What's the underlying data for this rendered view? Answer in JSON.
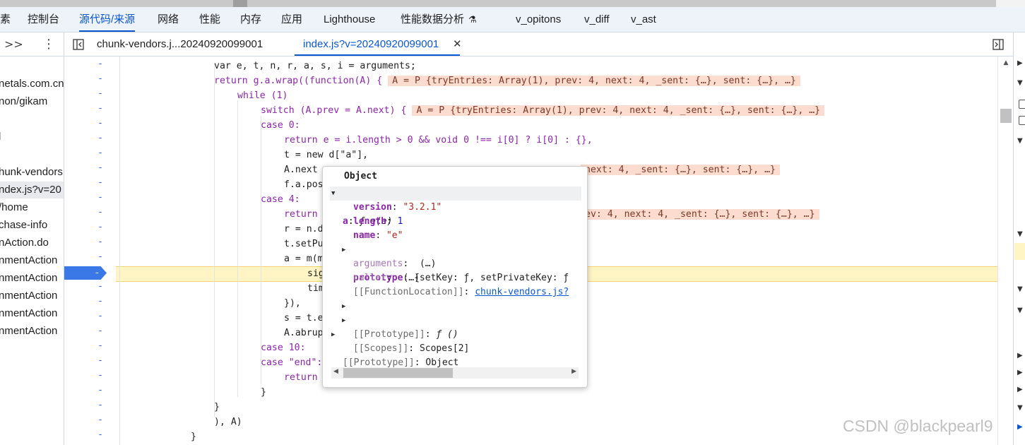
{
  "main_tabs": [
    {
      "label": "素",
      "active": false
    },
    {
      "label": "控制台",
      "active": false
    },
    {
      "label": "源代码/来源",
      "active": true
    },
    {
      "label": "网络",
      "active": false
    },
    {
      "label": "性能",
      "active": false
    },
    {
      "label": "内存",
      "active": false
    },
    {
      "label": "应用",
      "active": false
    },
    {
      "label": "Lighthouse",
      "active": false
    },
    {
      "label": "性能数据分析",
      "active": false
    },
    {
      "label": "v_opitons",
      "active": false
    },
    {
      "label": "v_diff",
      "active": false
    },
    {
      "label": "v_ast",
      "active": false
    }
  ],
  "file_tabs": [
    {
      "label": "chunk-vendors.j...20240920099001",
      "active": false
    },
    {
      "label": "index.js?v=20240920099001",
      "active": true
    }
  ],
  "icons": {
    "more_tabs": ">>",
    "menu": "⋮",
    "toggle_nav": "sidebar-toggle",
    "close": "✕",
    "toggle_debugger": "sidebar-toggle-right",
    "flask": "⚗"
  },
  "navigator": [
    "netals.com.cn",
    "non/gikam",
    "l",
    "hunk-vendors",
    "ndex.js?v=20",
    "/home",
    "chase-info",
    "nAction.do",
    "nmentAction",
    "nmentAction",
    "nmentAction",
    "nmentAction",
    "nmentAction"
  ],
  "code": {
    "gutter_marker": "-",
    "breakpoint_marker": "-",
    "lines": [
      "var e, t, n, r, a, s, i = arguments;",
      "return g.a.wrap((function(A) {",
      "while (1)",
      "switch (A.prev = A.next) {",
      "case 0:",
      "return e = i.length > 0 && void 0 !== i[0] ? i[0] : {},",
      "t = new d[\"a\"],",
      "A.next",
      "f.a.pos",
      "case 4:",
      "return",
      "r = n.d",
      "t.setPu",
      "a = m(m",
      "sig",
      "tim",
      "}),",
      "s = t.e",
      "A.abrup",
      "case 10:",
      "case \"end\":",
      "return",
      "}",
      "}",
      "), A)",
      "}"
    ],
    "inline_values": [
      "A = P {tryEntries: Array(1), prev: 4, next: 4, _sent: {…}, sent: {…}, …}",
      "A = P {tryEntries: Array(1), prev: 4, next: 4, _sent: {…}, sent: {…}, …}",
      "next: 4, _sent: {…}, sent: {…}, …}",
      "ev: 4, next: 4, _sent: {…}, sent: {…}, …}"
    ]
  },
  "popup": {
    "title": "Object",
    "rows": [
      {
        "key": "a",
        "value": "ƒ e(e)"
      },
      {
        "key": "version",
        "value": "\"3.2.1\""
      },
      {
        "key": "length",
        "value": "1"
      },
      {
        "key": "name",
        "value": "\"e\""
      },
      {
        "key": "prototype",
        "value": "{setKey: ƒ, setPrivateKey: ƒ"
      },
      {
        "key": "arguments",
        "value": "(…)"
      },
      {
        "key": "caller",
        "value": "(…)"
      },
      {
        "key": "[[FunctionLocation]]",
        "value": "chunk-vendors.js?"
      },
      {
        "key": "[[Prototype]]",
        "value": "ƒ ()"
      },
      {
        "key": "[[Scopes]]",
        "value": "Scopes[2]"
      },
      {
        "key": "[[Prototype]]",
        "value": "Object"
      }
    ]
  },
  "watermark": "CSDN @blackpearl9"
}
